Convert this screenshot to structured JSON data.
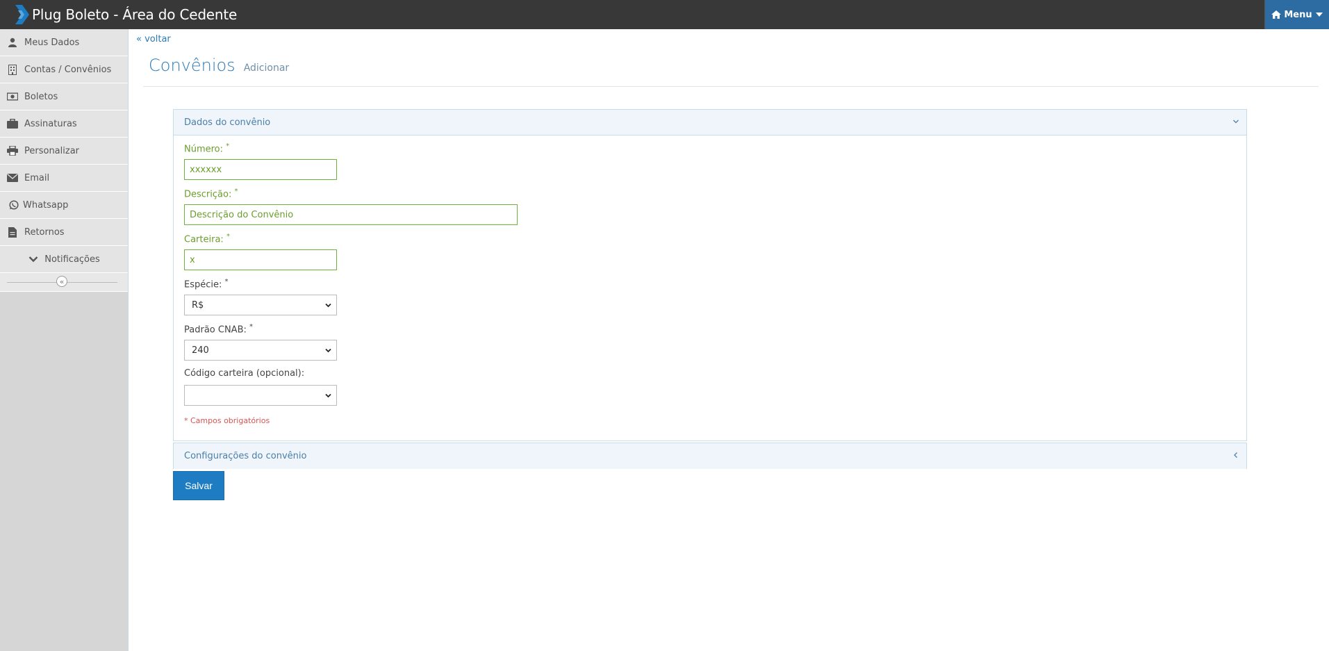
{
  "header": {
    "title": "Plug Boleto - Área do Cedente",
    "menu_label": "Menu",
    "menu_icon": "home-icon"
  },
  "sidebar": {
    "items": [
      {
        "label": "Meus Dados",
        "icon": "user-icon"
      },
      {
        "label": "Contas / Convênios",
        "icon": "building-icon"
      },
      {
        "label": "Boletos",
        "icon": "money-icon"
      },
      {
        "label": "Assinaturas",
        "icon": "briefcase-icon"
      },
      {
        "label": "Personalizar",
        "icon": "print-icon"
      },
      {
        "label": "Email",
        "icon": "envelope-icon"
      },
      {
        "label": "Whatsapp",
        "icon": "whatsapp-icon"
      },
      {
        "label": "Retornos",
        "icon": "file-icon"
      },
      {
        "label": "Notificações",
        "icon": "chevron-down-icon"
      }
    ],
    "collapse_glyph": "«"
  },
  "main": {
    "back_link": "« voltar",
    "title": "Convênios",
    "subtitle": "Adicionar",
    "panel1": {
      "title": "Dados do convênio",
      "fields": {
        "numero": {
          "label": "Número:",
          "value": "xxxxxx"
        },
        "descricao": {
          "label": "Descrição:",
          "value": "Descrição do Convênio"
        },
        "carteira": {
          "label": "Carteira:",
          "value": "x"
        },
        "especie": {
          "label": "Espécie:",
          "value": "R$"
        },
        "cnab": {
          "label": "Padrão CNAB:",
          "value": "240"
        },
        "codigo": {
          "label": "Código carteira (opcional):",
          "value": ""
        }
      },
      "required_marker": "*",
      "required_note": "* Campos obrigatórios"
    },
    "panel2": {
      "title": "Configurações do convênio"
    },
    "save_label": "Salvar"
  },
  "colors": {
    "navbar": "#383838",
    "menu_button": "#2d6ca2",
    "accent": "#2a7ab8",
    "valid_green": "#6bb33a",
    "required_red": "#d9534f",
    "save_button": "#1e7dc2"
  }
}
